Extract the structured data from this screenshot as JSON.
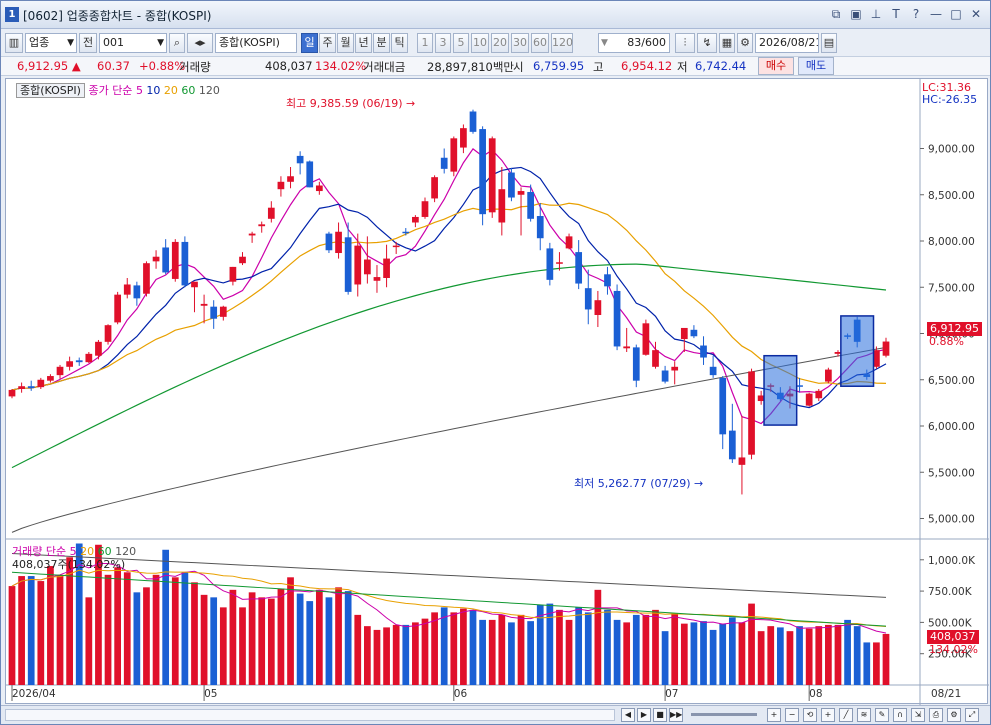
{
  "window": {
    "badge": "1",
    "title": "[0602] 업종종합차트 - 종합(KOSPI)"
  },
  "toolbar": {
    "market_select": "업종",
    "market_btn": "전",
    "code": "001",
    "name_field": "종합(KOSPI)",
    "periods": [
      "일",
      "주",
      "월",
      "년",
      "분",
      "틱"
    ],
    "active_period": "일",
    "intervals": [
      "1",
      "3",
      "5",
      "10",
      "20",
      "30",
      "60",
      "120"
    ],
    "count": "83/600",
    "date": "2026/08/21"
  },
  "quote": {
    "price": "6,912.95",
    "change": "60.37",
    "change_pct": "+0.88%",
    "volume_label": "거래량",
    "volume": "408,037",
    "volume_pct": "134.02%",
    "amount_label": "거래대금",
    "amount": "28,897,810백만",
    "open_label": "시",
    "open": "6,759.95",
    "high_label": "고",
    "high": "6,954.12",
    "low_label": "저",
    "low": "6,742.44",
    "buy_label": "매수",
    "sell_label": "매도"
  },
  "price_panel": {
    "tag": "종합(KOSPI)",
    "legend_title": "종가 단순",
    "ma_labels": [
      "5",
      "10",
      "20",
      "60",
      "120"
    ],
    "ma_colors": [
      "#cc00aa",
      "#0022aa",
      "#e8a000",
      "#129832",
      "#555555"
    ],
    "lc": "LC:31.36",
    "hc": "HC:-26.35",
    "high_annot": "최고 9,385.59 (06/19)",
    "low_annot": "최저 5,262.77 (07/29)",
    "last_price_tag": "6,912.95",
    "last_pct_tag": "0.88%",
    "yticks": [
      "9,000.00",
      "8,500.00",
      "8,000.00",
      "7,500.00",
      "7,000.00",
      "6,500.00",
      "6,000.00",
      "5,500.00",
      "5,000.00"
    ]
  },
  "volume_panel": {
    "legend_title": "거래량",
    "legend_ma": "단순",
    "ma_labels": [
      "5",
      "20",
      "60",
      "120"
    ],
    "current": "408,037주(134.02%)",
    "yticks": [
      "1,000.0K",
      "750.00K",
      "500.00K",
      "250.00K"
    ],
    "last_tag": "408,037",
    "last_pct_tag": "134.02%"
  },
  "xaxis": {
    "labels": [
      "2026/04",
      "05",
      "06",
      "07",
      "08"
    ],
    "right_label": "08/21"
  },
  "colors": {
    "up": "#e0102a",
    "down": "#1a5fd4",
    "ma5": "#cc00aa",
    "ma10": "#0022aa",
    "ma20": "#e8a000",
    "ma60": "#129832",
    "ma120": "#555555"
  },
  "chart_data": {
    "type": "candlestick",
    "price_range": [
      4800,
      9600
    ],
    "volume_range": [
      0,
      1150
    ],
    "candles": [
      {
        "o": 6320,
        "h": 6400,
        "l": 6300,
        "c": 6390,
        "v": 790
      },
      {
        "o": 6400,
        "h": 6470,
        "l": 6360,
        "c": 6430,
        "v": 870
      },
      {
        "o": 6430,
        "h": 6490,
        "l": 6380,
        "c": 6410,
        "v": 870
      },
      {
        "o": 6420,
        "h": 6520,
        "l": 6400,
        "c": 6500,
        "v": 830
      },
      {
        "o": 6490,
        "h": 6560,
        "l": 6470,
        "c": 6540,
        "v": 950
      },
      {
        "o": 6550,
        "h": 6660,
        "l": 6510,
        "c": 6640,
        "v": 880
      },
      {
        "o": 6640,
        "h": 6750,
        "l": 6600,
        "c": 6700,
        "v": 1020
      },
      {
        "o": 6710,
        "h": 6740,
        "l": 6650,
        "c": 6690,
        "v": 1130
      },
      {
        "o": 6690,
        "h": 6800,
        "l": 6680,
        "c": 6780,
        "v": 700
      },
      {
        "o": 6760,
        "h": 6930,
        "l": 6720,
        "c": 6910,
        "v": 1120
      },
      {
        "o": 6910,
        "h": 7100,
        "l": 6880,
        "c": 7090,
        "v": 880
      },
      {
        "o": 7120,
        "h": 7450,
        "l": 7100,
        "c": 7420,
        "v": 940
      },
      {
        "o": 7420,
        "h": 7600,
        "l": 7380,
        "c": 7530,
        "v": 900
      },
      {
        "o": 7520,
        "h": 7560,
        "l": 7300,
        "c": 7380,
        "v": 740
      },
      {
        "o": 7430,
        "h": 7780,
        "l": 7400,
        "c": 7760,
        "v": 780
      },
      {
        "o": 7780,
        "h": 7900,
        "l": 7700,
        "c": 7830,
        "v": 880
      },
      {
        "o": 7930,
        "h": 8020,
        "l": 7640,
        "c": 7660,
        "v": 1080
      },
      {
        "o": 7590,
        "h": 8020,
        "l": 7560,
        "c": 7990,
        "v": 860
      },
      {
        "o": 7990,
        "h": 8050,
        "l": 7500,
        "c": 7520,
        "v": 900
      },
      {
        "o": 7500,
        "h": 7560,
        "l": 7230,
        "c": 7560,
        "v": 820
      },
      {
        "o": 7300,
        "h": 7420,
        "l": 7110,
        "c": 7320,
        "v": 720
      },
      {
        "o": 7290,
        "h": 7360,
        "l": 7050,
        "c": 7160,
        "v": 700
      },
      {
        "o": 7180,
        "h": 7300,
        "l": 7140,
        "c": 7290,
        "v": 620
      },
      {
        "o": 7560,
        "h": 7720,
        "l": 7520,
        "c": 7720,
        "v": 760
      },
      {
        "o": 7760,
        "h": 7880,
        "l": 7740,
        "c": 7830,
        "v": 620
      },
      {
        "o": 8060,
        "h": 8100,
        "l": 7980,
        "c": 8080,
        "v": 740
      },
      {
        "o": 8160,
        "h": 8210,
        "l": 8090,
        "c": 8180,
        "v": 700
      },
      {
        "o": 8240,
        "h": 8430,
        "l": 8200,
        "c": 8360,
        "v": 690
      },
      {
        "o": 8560,
        "h": 8700,
        "l": 8480,
        "c": 8640,
        "v": 770
      },
      {
        "o": 8640,
        "h": 8800,
        "l": 8570,
        "c": 8700,
        "v": 860
      },
      {
        "o": 8920,
        "h": 8970,
        "l": 8720,
        "c": 8840,
        "v": 730
      },
      {
        "o": 8860,
        "h": 8870,
        "l": 8580,
        "c": 8580,
        "v": 670
      },
      {
        "o": 8540,
        "h": 8640,
        "l": 8500,
        "c": 8600,
        "v": 760
      },
      {
        "o": 8080,
        "h": 8100,
        "l": 7870,
        "c": 7900,
        "v": 700
      },
      {
        "o": 7870,
        "h": 8200,
        "l": 7810,
        "c": 8100,
        "v": 780
      },
      {
        "o": 8040,
        "h": 8200,
        "l": 7420,
        "c": 7450,
        "v": 750
      },
      {
        "o": 7530,
        "h": 8080,
        "l": 7400,
        "c": 7950,
        "v": 560
      },
      {
        "o": 7640,
        "h": 8050,
        "l": 7540,
        "c": 7800,
        "v": 470
      },
      {
        "o": 7570,
        "h": 7740,
        "l": 7440,
        "c": 7610,
        "v": 440
      },
      {
        "o": 7600,
        "h": 7960,
        "l": 7500,
        "c": 7810,
        "v": 460
      },
      {
        "o": 7940,
        "h": 7990,
        "l": 7860,
        "c": 7950,
        "v": 480
      },
      {
        "o": 8100,
        "h": 8140,
        "l": 8060,
        "c": 8090,
        "v": 480
      },
      {
        "o": 8200,
        "h": 8280,
        "l": 8150,
        "c": 8260,
        "v": 500
      },
      {
        "o": 8260,
        "h": 8470,
        "l": 8240,
        "c": 8430,
        "v": 530
      },
      {
        "o": 8460,
        "h": 8710,
        "l": 8420,
        "c": 8690,
        "v": 580
      },
      {
        "o": 8900,
        "h": 9000,
        "l": 8730,
        "c": 8780,
        "v": 620
      },
      {
        "o": 8750,
        "h": 9130,
        "l": 8700,
        "c": 9110,
        "v": 580
      },
      {
        "o": 9010,
        "h": 9260,
        "l": 8950,
        "c": 9220,
        "v": 610
      },
      {
        "o": 9400,
        "h": 9420,
        "l": 9160,
        "c": 9180,
        "v": 600
      },
      {
        "o": 9210,
        "h": 9240,
        "l": 8170,
        "c": 8290,
        "v": 520
      },
      {
        "o": 8310,
        "h": 9130,
        "l": 8250,
        "c": 9110,
        "v": 520
      },
      {
        "o": 8200,
        "h": 8800,
        "l": 8060,
        "c": 8560,
        "v": 560
      },
      {
        "o": 8740,
        "h": 8790,
        "l": 8430,
        "c": 8470,
        "v": 500
      },
      {
        "o": 8500,
        "h": 8580,
        "l": 8060,
        "c": 8540,
        "v": 560
      },
      {
        "o": 8530,
        "h": 8610,
        "l": 8210,
        "c": 8240,
        "v": 510
      },
      {
        "o": 8270,
        "h": 8410,
        "l": 7900,
        "c": 8030,
        "v": 640
      },
      {
        "o": 7920,
        "h": 7980,
        "l": 7520,
        "c": 7580,
        "v": 650
      },
      {
        "o": 7760,
        "h": 7880,
        "l": 7680,
        "c": 7770,
        "v": 600
      },
      {
        "o": 7920,
        "h": 8080,
        "l": 7910,
        "c": 8050,
        "v": 520
      },
      {
        "o": 7880,
        "h": 8010,
        "l": 7480,
        "c": 7540,
        "v": 620
      },
      {
        "o": 7490,
        "h": 7690,
        "l": 7100,
        "c": 7260,
        "v": 580
      },
      {
        "o": 7200,
        "h": 7460,
        "l": 7070,
        "c": 7360,
        "v": 760
      },
      {
        "o": 7640,
        "h": 7720,
        "l": 7420,
        "c": 7510,
        "v": 600
      },
      {
        "o": 7460,
        "h": 7530,
        "l": 6820,
        "c": 6860,
        "v": 520
      },
      {
        "o": 6840,
        "h": 7060,
        "l": 6800,
        "c": 6860,
        "v": 500
      },
      {
        "o": 6850,
        "h": 6880,
        "l": 6420,
        "c": 6490,
        "v": 560
      },
      {
        "o": 6770,
        "h": 7150,
        "l": 6760,
        "c": 7110,
        "v": 560
      },
      {
        "o": 6640,
        "h": 6910,
        "l": 6620,
        "c": 6820,
        "v": 600
      },
      {
        "o": 6600,
        "h": 6650,
        "l": 6460,
        "c": 6480,
        "v": 430
      },
      {
        "o": 6600,
        "h": 6700,
        "l": 6450,
        "c": 6640,
        "v": 570
      },
      {
        "o": 6940,
        "h": 7050,
        "l": 6800,
        "c": 7060,
        "v": 490
      },
      {
        "o": 7040,
        "h": 7090,
        "l": 6950,
        "c": 6970,
        "v": 500
      },
      {
        "o": 6870,
        "h": 6970,
        "l": 6660,
        "c": 6740,
        "v": 510
      },
      {
        "o": 6640,
        "h": 6760,
        "l": 6520,
        "c": 6550,
        "v": 440
      },
      {
        "o": 6520,
        "h": 6540,
        "l": 5750,
        "c": 5910,
        "v": 490
      },
      {
        "o": 5950,
        "h": 6240,
        "l": 5600,
        "c": 5640,
        "v": 540
      },
      {
        "o": 5580,
        "h": 6110,
        "l": 5260,
        "c": 5660,
        "v": 500
      },
      {
        "o": 5690,
        "h": 6620,
        "l": 5640,
        "c": 6590,
        "v": 650
      },
      {
        "o": 6270,
        "h": 6380,
        "l": 6230,
        "c": 6330,
        "v": 430
      },
      {
        "o": 6430,
        "h": 6460,
        "l": 6370,
        "c": 6440,
        "v": 470
      },
      {
        "o": 6360,
        "h": 6420,
        "l": 6270,
        "c": 6290,
        "v": 460
      },
      {
        "o": 6320,
        "h": 6430,
        "l": 6190,
        "c": 6350,
        "v": 430
      },
      {
        "o": 6440,
        "h": 6520,
        "l": 6360,
        "c": 6430,
        "v": 470
      }
    ],
    "tail_candles": [
      {
        "o": 6220,
        "h": 6360,
        "l": 6210,
        "c": 6350,
        "v": 450
      },
      {
        "o": 6300,
        "h": 6400,
        "l": 6270,
        "c": 6380,
        "v": 470
      },
      {
        "o": 6480,
        "h": 6630,
        "l": 6460,
        "c": 6610,
        "v": 480
      },
      {
        "o": 6780,
        "h": 6820,
        "l": 6750,
        "c": 6800,
        "v": 480
      },
      {
        "o": 6980,
        "h": 7000,
        "l": 6940,
        "c": 6970,
        "v": 520
      },
      {
        "o": 7150,
        "h": 7180,
        "l": 6850,
        "c": 6910,
        "v": 470
      },
      {
        "o": 6560,
        "h": 6610,
        "l": 6500,
        "c": 6530,
        "v": 340
      },
      {
        "o": 6640,
        "h": 6860,
        "l": 6620,
        "c": 6820,
        "v": 340
      },
      {
        "o": 6760,
        "h": 6954,
        "l": 6742,
        "c": 6913,
        "v": 408
      }
    ]
  }
}
